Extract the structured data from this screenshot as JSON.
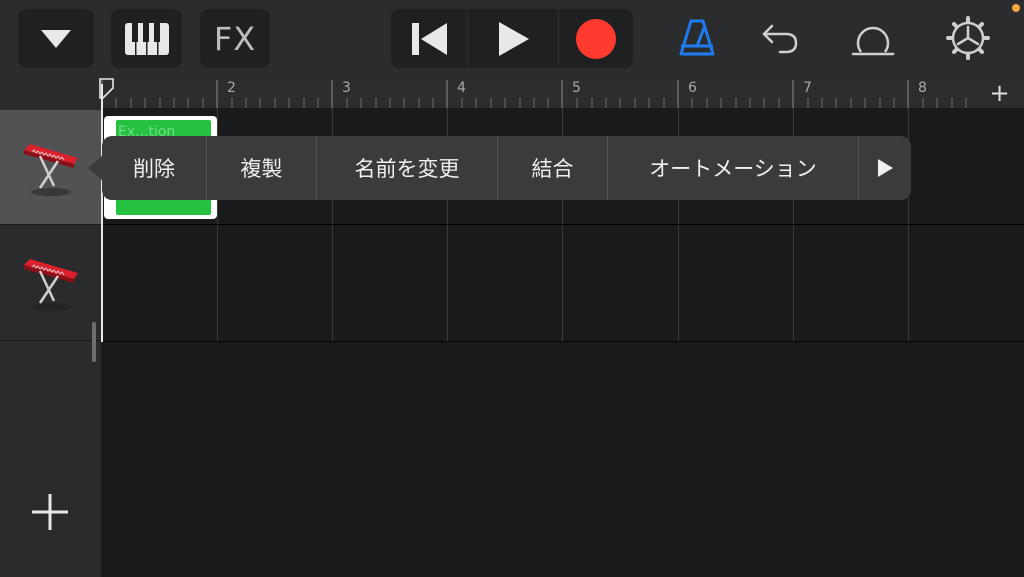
{
  "toolbar": {
    "view_dropdown_icon": "triangle-down-icon",
    "keyboard_icon": "piano-keys-icon",
    "fx_label": "FX",
    "transport": {
      "rewind_icon": "go-to-beginning-icon",
      "play_icon": "play-icon",
      "record_icon": "record-icon"
    },
    "metronome_icon": "metronome-icon",
    "undo_icon": "undo-icon",
    "loop_icon": "loop-browser-icon",
    "settings_icon": "gear-icon",
    "colors": {
      "record": "#ff3b30",
      "metronome_active": "#1e7cf2"
    }
  },
  "ruler": {
    "bars": [
      "2",
      "3",
      "4",
      "5",
      "6",
      "7",
      "8"
    ],
    "add_section_label": "+"
  },
  "tracks": [
    {
      "instrument_icon": "keyboard-instrument-icon",
      "selected": true
    },
    {
      "instrument_icon": "keyboard-instrument-icon",
      "selected": false
    }
  ],
  "region": {
    "name": "Ex...tion",
    "color": "#25c241"
  },
  "context_menu": {
    "items": [
      "削除",
      "複製",
      "名前を変更",
      "結合",
      "オートメーション"
    ],
    "more_icon": "play-right-icon"
  },
  "sidebar": {
    "add_track_label": "+"
  }
}
